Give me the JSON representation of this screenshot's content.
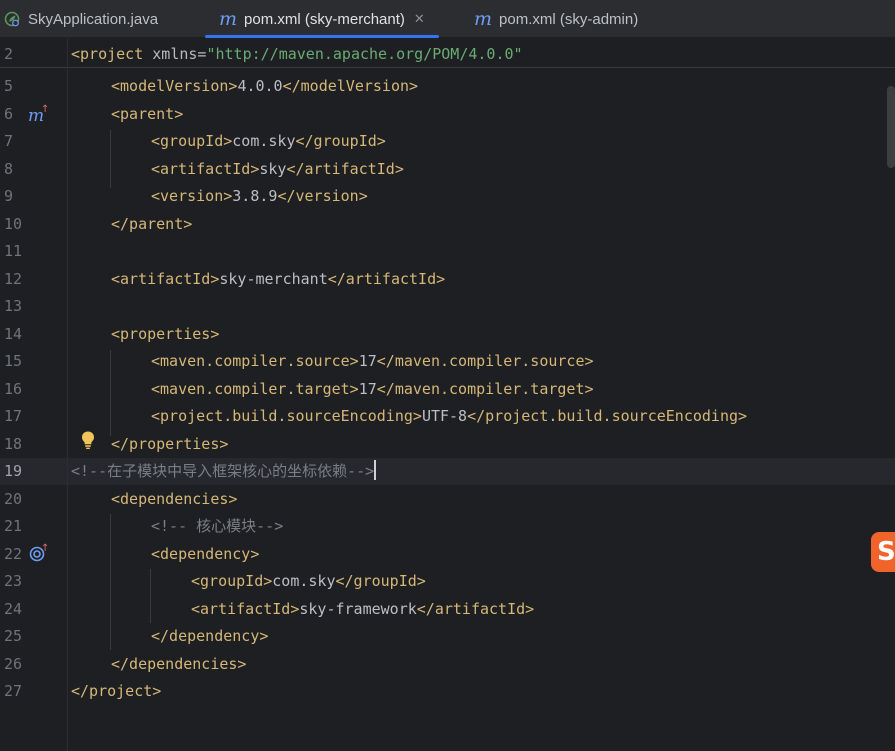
{
  "tabs": [
    {
      "label": "SkyApplication.java",
      "icon": "spring-boot-java-icon",
      "active": false
    },
    {
      "label": "pom.xml (sky-merchant)",
      "icon": "maven-icon",
      "active": true,
      "close": "✕"
    },
    {
      "label": "pom.xml (sky-admin)",
      "icon": "maven-icon",
      "active": false
    }
  ],
  "editor": {
    "current_line": 19,
    "sticky": {
      "line_number": "2",
      "code": {
        "tag_open": "<project",
        "attr": " xmlns=",
        "value": "\"http://maven.apache.org/POM/4.0.0\""
      }
    },
    "lines": [
      {
        "n": "5",
        "open": "<modelVersion>",
        "text": "4.0.0",
        "close": "</modelVersion>"
      },
      {
        "n": "6",
        "open": "<parent>"
      },
      {
        "n": "7",
        "open": "<groupId>",
        "text": "com.sky",
        "close": "</groupId>"
      },
      {
        "n": "8",
        "open": "<artifactId>",
        "text": "sky",
        "close": "</artifactId>"
      },
      {
        "n": "9",
        "open": "<version>",
        "text": "3.8.9",
        "close": "</version>"
      },
      {
        "n": "10",
        "open": "</parent>"
      },
      {
        "n": "11"
      },
      {
        "n": "12",
        "open": "<artifactId>",
        "text": "sky-merchant",
        "close": "</artifactId>"
      },
      {
        "n": "13"
      },
      {
        "n": "14",
        "open": "<properties>"
      },
      {
        "n": "15",
        "open": "<maven.compiler.source>",
        "text": "17",
        "close": "</maven.compiler.source>"
      },
      {
        "n": "16",
        "open": "<maven.compiler.target>",
        "text": "17",
        "close": "</maven.compiler.target>"
      },
      {
        "n": "17",
        "open": "<project.build.sourceEncoding>",
        "text": "UTF-8",
        "close": "</project.build.sourceEncoding>"
      },
      {
        "n": "18",
        "open": "</properties>"
      },
      {
        "n": "19",
        "comment": "<!--在子模块中导入框架核心的坐标依赖-->"
      },
      {
        "n": "20",
        "open": "<dependencies>"
      },
      {
        "n": "21",
        "comment": "<!-- 核心模块-->"
      },
      {
        "n": "22",
        "open": "<dependency>"
      },
      {
        "n": "23",
        "open": "<groupId>",
        "text": "com.sky",
        "close": "</groupId>"
      },
      {
        "n": "24",
        "open": "<artifactId>",
        "text": "sky-framework",
        "close": "</artifactId>"
      },
      {
        "n": "25",
        "open": "</dependency>"
      },
      {
        "n": "26",
        "open": "</dependencies>"
      },
      {
        "n": "27",
        "open": "</project>"
      }
    ]
  },
  "gutter_icons": {
    "line6": "maven-parent-icon",
    "line22": "dependency-icon",
    "line18": "lightbulb-icon"
  },
  "ime_badge": {
    "label": "S",
    "color": "#f0642b"
  },
  "colors": {
    "background": "#1e1f22",
    "tabbar": "#2b2d30",
    "active_tab_underline": "#3574f0",
    "tag": "#d5b778",
    "string": "#6aab73",
    "comment": "#7a7e85",
    "text": "#bcbec4"
  }
}
